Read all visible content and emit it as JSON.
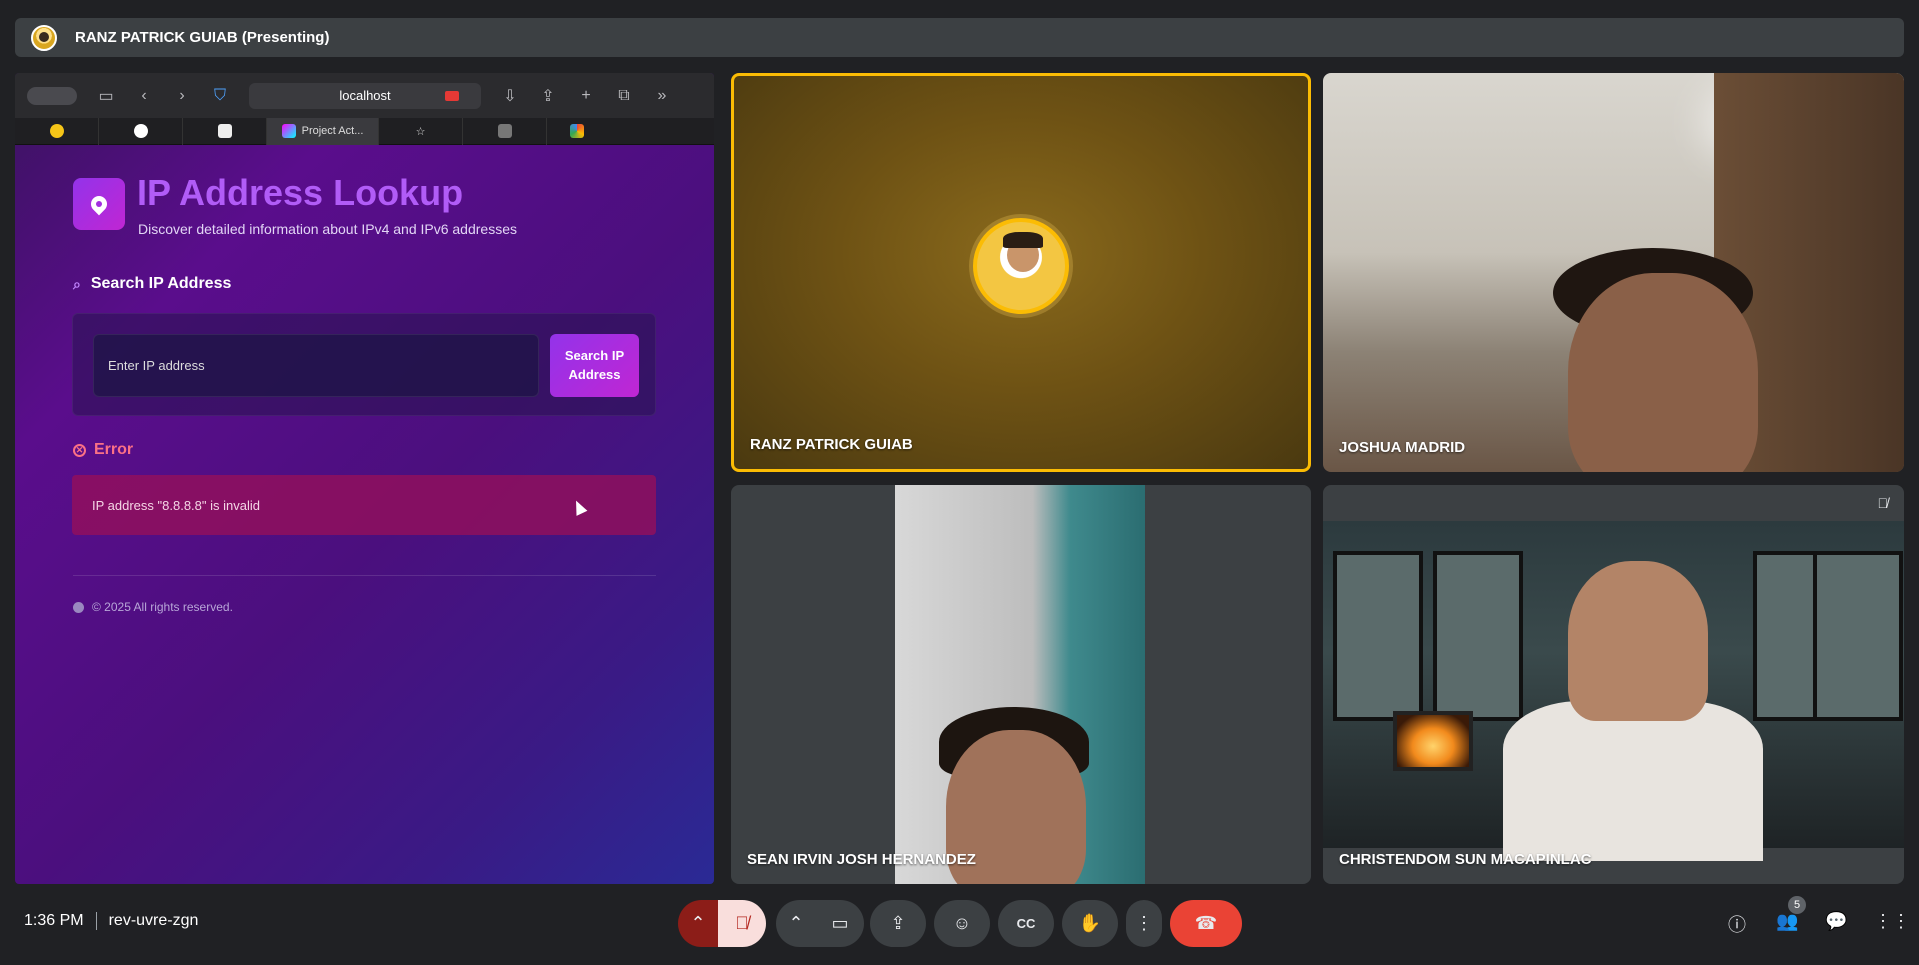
{
  "topbar": {
    "presenter": "RANZ PATRICK GUIAB (Presenting)"
  },
  "browser": {
    "url": "localhost",
    "active_tab": "Project Act...",
    "tab_icons": [
      "emoji-icon",
      "github-icon",
      "app-icon",
      "app2-icon",
      "project-icon",
      "star-icon",
      "l-icon",
      "google-icon"
    ]
  },
  "app": {
    "title": "IP Address Lookup",
    "subtitle": "Discover detailed information about IPv4 and IPv6 addresses",
    "search_heading": "Search IP Address",
    "input_placeholder": "Enter IP address",
    "search_button": "Search IP Address",
    "error_heading": "Error",
    "error_message": "IP address \"8.8.8.8\" is invalid",
    "footer": "© 2025 All rights reserved."
  },
  "participants": [
    {
      "name": "RANZ PATRICK GUIAB",
      "speaking": true
    },
    {
      "name": "JOSHUA MADRID"
    },
    {
      "name": "SEAN IRVIN JOSH HERNANDEZ"
    },
    {
      "name": "CHRISTENDOM SUN MACAPINLAC",
      "muted": true
    }
  ],
  "meeting": {
    "time": "1:36 PM",
    "code": "rev-uvre-zgn",
    "participant_count": "5"
  },
  "colors": {
    "accent": "#fbbc04",
    "end_call": "#ea4335",
    "app_purple": "#9333ea"
  }
}
